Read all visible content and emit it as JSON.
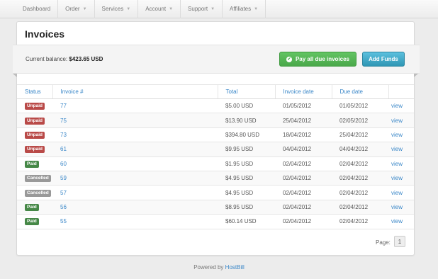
{
  "nav": {
    "items": [
      {
        "label": "Dashboard",
        "caret": false
      },
      {
        "label": "Order",
        "caret": true
      },
      {
        "label": "Services",
        "caret": true
      },
      {
        "label": "Account",
        "caret": true
      },
      {
        "label": "Support",
        "caret": true
      },
      {
        "label": "Affiliates",
        "caret": true
      }
    ]
  },
  "page": {
    "title": "Invoices",
    "balance_label": "Current balance:",
    "balance_value": "$423.65 USD",
    "pay_button": "Pay all due invoices",
    "add_funds_button": "Add Funds"
  },
  "table": {
    "headers": [
      "Status",
      "Invoice #",
      "Total",
      "Invoice date",
      "Due date",
      ""
    ],
    "rows": [
      {
        "status": "Unpaid",
        "invoice": "77",
        "total": "$5.00 USD",
        "invoice_date": "01/05/2012",
        "due_date": "01/05/2012",
        "action": "view"
      },
      {
        "status": "Unpaid",
        "invoice": "75",
        "total": "$13.90 USD",
        "invoice_date": "25/04/2012",
        "due_date": "02/05/2012",
        "action": "view"
      },
      {
        "status": "Unpaid",
        "invoice": "73",
        "total": "$394.80 USD",
        "invoice_date": "18/04/2012",
        "due_date": "25/04/2012",
        "action": "view"
      },
      {
        "status": "Unpaid",
        "invoice": "61",
        "total": "$9.95 USD",
        "invoice_date": "04/04/2012",
        "due_date": "04/04/2012",
        "action": "view"
      },
      {
        "status": "Paid",
        "invoice": "60",
        "total": "$1.95 USD",
        "invoice_date": "02/04/2012",
        "due_date": "02/04/2012",
        "action": "view"
      },
      {
        "status": "Cancelled",
        "invoice": "59",
        "total": "$4.95 USD",
        "invoice_date": "02/04/2012",
        "due_date": "02/04/2012",
        "action": "view"
      },
      {
        "status": "Cancelled",
        "invoice": "57",
        "total": "$4.95 USD",
        "invoice_date": "02/04/2012",
        "due_date": "02/04/2012",
        "action": "view"
      },
      {
        "status": "Paid",
        "invoice": "56",
        "total": "$8.95 USD",
        "invoice_date": "02/04/2012",
        "due_date": "02/04/2012",
        "action": "view"
      },
      {
        "status": "Paid",
        "invoice": "55",
        "total": "$60.14 USD",
        "invoice_date": "02/04/2012",
        "due_date": "02/04/2012",
        "action": "view"
      }
    ]
  },
  "status_colors": {
    "Unpaid": "#b94a48",
    "Paid": "#468847",
    "Cancelled": "#999999"
  },
  "pager": {
    "label": "Page:",
    "current": "1"
  },
  "footer": {
    "prefix": "Powered by",
    "brand": "HostBill"
  }
}
